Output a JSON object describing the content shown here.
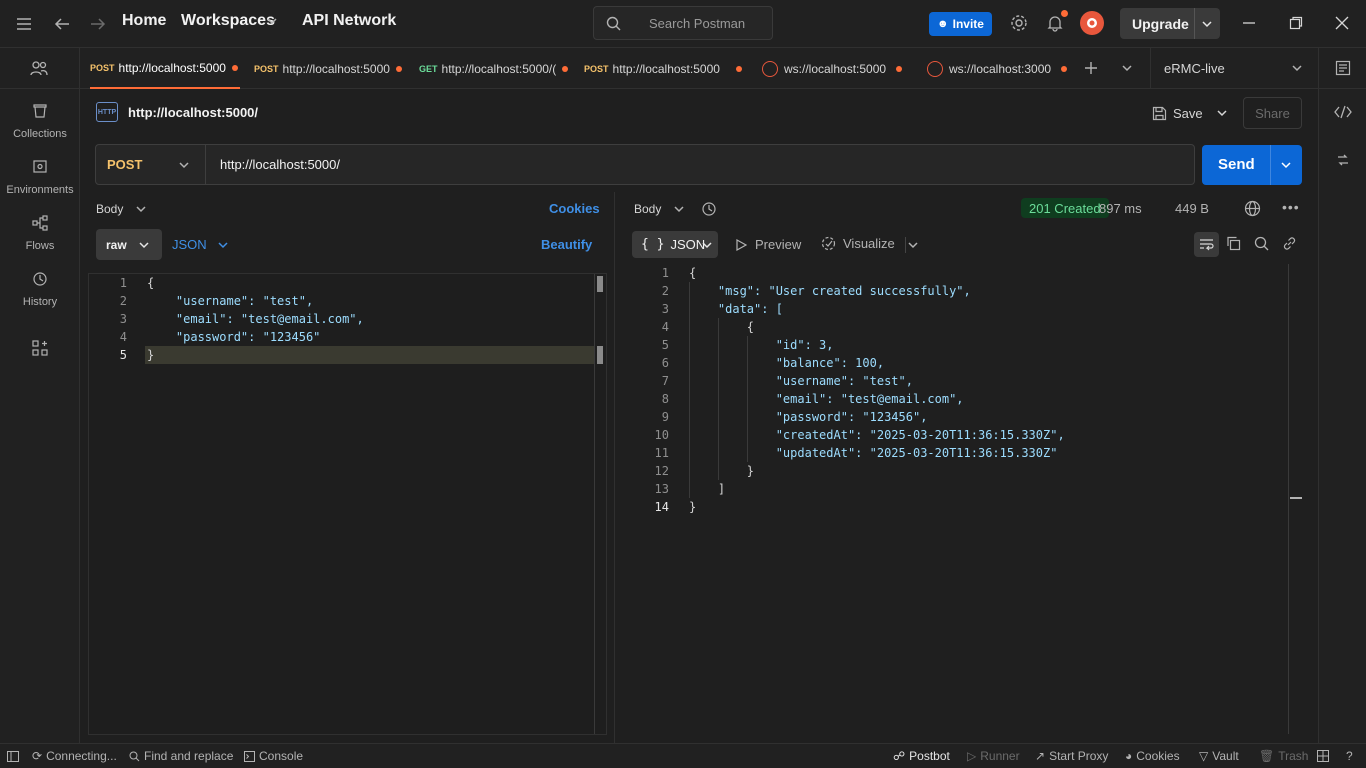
{
  "topbar": {
    "home": "Home",
    "workspaces": "Workspaces",
    "api_network": "API Network",
    "search_placeholder": "Search Postman",
    "invite": "Invite",
    "upgrade": "Upgrade"
  },
  "sidebar": {
    "items": [
      {
        "label": "Collections",
        "icon": "collections-icon"
      },
      {
        "label": "Environments",
        "icon": "environments-icon"
      },
      {
        "label": "Flows",
        "icon": "flows-icon"
      },
      {
        "label": "History",
        "icon": "history-icon"
      }
    ]
  },
  "tabs": [
    {
      "method": "POST",
      "url": "http://localhost:5000",
      "active": true
    },
    {
      "method": "POST",
      "url": "http://localhost:5000"
    },
    {
      "method": "GET",
      "url": "http://localhost:5000/("
    },
    {
      "method": "POST",
      "url": "http://localhost:5000"
    },
    {
      "method": "",
      "url": "ws://localhost:5000"
    },
    {
      "method": "",
      "url": "ws://localhost:3000"
    }
  ],
  "environment": "eRMC-live",
  "request": {
    "title": "http://localhost:5000/",
    "save": "Save",
    "share": "Share",
    "method": "POST",
    "url": "http://localhost:5000/",
    "send": "Send",
    "body_label": "Body",
    "cookies": "Cookies",
    "raw": "raw",
    "format": "JSON",
    "beautify": "Beautify",
    "code_lines": [
      "{",
      "    \"username\": \"test\",",
      "    \"email\": \"test@email.com\",",
      "    \"password\": \"123456\"",
      "}"
    ]
  },
  "response": {
    "body_label": "Body",
    "status": "201 Created",
    "time": "897 ms",
    "size": "449 B",
    "format": "JSON",
    "preview": "Preview",
    "visualize": "Visualize",
    "code_lines": [
      "{",
      "    \"msg\": \"User created successfully\",",
      "    \"data\": [",
      "        {",
      "            \"id\": 3,",
      "            \"balance\": 100,",
      "            \"username\": \"test\",",
      "            \"email\": \"test@email.com\",",
      "            \"password\": \"123456\",",
      "            \"createdAt\": \"2025-03-20T11:36:15.330Z\",",
      "            \"updatedAt\": \"2025-03-20T11:36:15.330Z\"",
      "        }",
      "    ]",
      "}"
    ]
  },
  "statusbar": {
    "connecting": "Connecting...",
    "find_replace": "Find and replace",
    "console": "Console",
    "postbot": "Postbot",
    "runner": "Runner",
    "start_proxy": "Start Proxy",
    "cookies": "Cookies",
    "vault": "Vault",
    "trash": "Trash"
  },
  "colors": {
    "accent_blue": "#0c67d6",
    "orange": "#ff6c37",
    "status_green": "#0f3d1f"
  }
}
